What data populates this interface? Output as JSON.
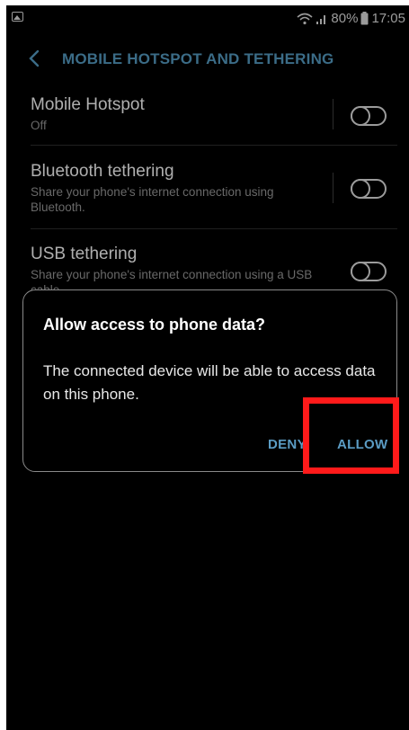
{
  "status_bar": {
    "battery": "80%",
    "time": "17:05"
  },
  "header": {
    "title": "MOBILE HOTSPOT AND TETHERING"
  },
  "settings": [
    {
      "title": "Mobile Hotspot",
      "subtitle": "Off",
      "enabled": false
    },
    {
      "title": "Bluetooth tethering",
      "subtitle": "Share your phone's internet connection using Bluetooth.",
      "enabled": false
    },
    {
      "title": "USB tethering",
      "subtitle": "Share your phone's internet connection using a USB cable.",
      "enabled": false
    }
  ],
  "dialog": {
    "title": "Allow access to phone data?",
    "message": "The connected device will be able to access data on this phone.",
    "deny_label": "DENY",
    "allow_label": "ALLOW"
  },
  "colors": {
    "accent": "#4f90b5",
    "highlight": "#ff1a1a",
    "background": "#000000"
  }
}
